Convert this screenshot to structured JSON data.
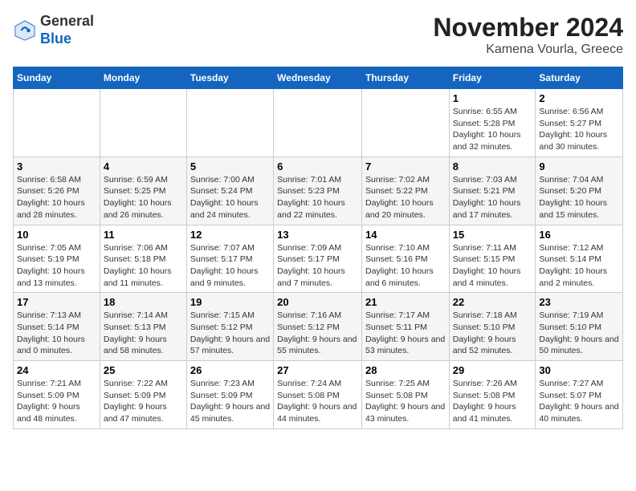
{
  "header": {
    "logo": {
      "line1": "General",
      "line2": "Blue"
    },
    "title": "November 2024",
    "location": "Kamena Vourla, Greece"
  },
  "weekdays": [
    "Sunday",
    "Monday",
    "Tuesday",
    "Wednesday",
    "Thursday",
    "Friday",
    "Saturday"
  ],
  "weeks": [
    [
      {
        "day": "",
        "info": ""
      },
      {
        "day": "",
        "info": ""
      },
      {
        "day": "",
        "info": ""
      },
      {
        "day": "",
        "info": ""
      },
      {
        "day": "",
        "info": ""
      },
      {
        "day": "1",
        "info": "Sunrise: 6:55 AM\nSunset: 5:28 PM\nDaylight: 10 hours and 32 minutes."
      },
      {
        "day": "2",
        "info": "Sunrise: 6:56 AM\nSunset: 5:27 PM\nDaylight: 10 hours and 30 minutes."
      }
    ],
    [
      {
        "day": "3",
        "info": "Sunrise: 6:58 AM\nSunset: 5:26 PM\nDaylight: 10 hours and 28 minutes."
      },
      {
        "day": "4",
        "info": "Sunrise: 6:59 AM\nSunset: 5:25 PM\nDaylight: 10 hours and 26 minutes."
      },
      {
        "day": "5",
        "info": "Sunrise: 7:00 AM\nSunset: 5:24 PM\nDaylight: 10 hours and 24 minutes."
      },
      {
        "day": "6",
        "info": "Sunrise: 7:01 AM\nSunset: 5:23 PM\nDaylight: 10 hours and 22 minutes."
      },
      {
        "day": "7",
        "info": "Sunrise: 7:02 AM\nSunset: 5:22 PM\nDaylight: 10 hours and 20 minutes."
      },
      {
        "day": "8",
        "info": "Sunrise: 7:03 AM\nSunset: 5:21 PM\nDaylight: 10 hours and 17 minutes."
      },
      {
        "day": "9",
        "info": "Sunrise: 7:04 AM\nSunset: 5:20 PM\nDaylight: 10 hours and 15 minutes."
      }
    ],
    [
      {
        "day": "10",
        "info": "Sunrise: 7:05 AM\nSunset: 5:19 PM\nDaylight: 10 hours and 13 minutes."
      },
      {
        "day": "11",
        "info": "Sunrise: 7:06 AM\nSunset: 5:18 PM\nDaylight: 10 hours and 11 minutes."
      },
      {
        "day": "12",
        "info": "Sunrise: 7:07 AM\nSunset: 5:17 PM\nDaylight: 10 hours and 9 minutes."
      },
      {
        "day": "13",
        "info": "Sunrise: 7:09 AM\nSunset: 5:17 PM\nDaylight: 10 hours and 7 minutes."
      },
      {
        "day": "14",
        "info": "Sunrise: 7:10 AM\nSunset: 5:16 PM\nDaylight: 10 hours and 6 minutes."
      },
      {
        "day": "15",
        "info": "Sunrise: 7:11 AM\nSunset: 5:15 PM\nDaylight: 10 hours and 4 minutes."
      },
      {
        "day": "16",
        "info": "Sunrise: 7:12 AM\nSunset: 5:14 PM\nDaylight: 10 hours and 2 minutes."
      }
    ],
    [
      {
        "day": "17",
        "info": "Sunrise: 7:13 AM\nSunset: 5:14 PM\nDaylight: 10 hours and 0 minutes."
      },
      {
        "day": "18",
        "info": "Sunrise: 7:14 AM\nSunset: 5:13 PM\nDaylight: 9 hours and 58 minutes."
      },
      {
        "day": "19",
        "info": "Sunrise: 7:15 AM\nSunset: 5:12 PM\nDaylight: 9 hours and 57 minutes."
      },
      {
        "day": "20",
        "info": "Sunrise: 7:16 AM\nSunset: 5:12 PM\nDaylight: 9 hours and 55 minutes."
      },
      {
        "day": "21",
        "info": "Sunrise: 7:17 AM\nSunset: 5:11 PM\nDaylight: 9 hours and 53 minutes."
      },
      {
        "day": "22",
        "info": "Sunrise: 7:18 AM\nSunset: 5:10 PM\nDaylight: 9 hours and 52 minutes."
      },
      {
        "day": "23",
        "info": "Sunrise: 7:19 AM\nSunset: 5:10 PM\nDaylight: 9 hours and 50 minutes."
      }
    ],
    [
      {
        "day": "24",
        "info": "Sunrise: 7:21 AM\nSunset: 5:09 PM\nDaylight: 9 hours and 48 minutes."
      },
      {
        "day": "25",
        "info": "Sunrise: 7:22 AM\nSunset: 5:09 PM\nDaylight: 9 hours and 47 minutes."
      },
      {
        "day": "26",
        "info": "Sunrise: 7:23 AM\nSunset: 5:09 PM\nDaylight: 9 hours and 45 minutes."
      },
      {
        "day": "27",
        "info": "Sunrise: 7:24 AM\nSunset: 5:08 PM\nDaylight: 9 hours and 44 minutes."
      },
      {
        "day": "28",
        "info": "Sunrise: 7:25 AM\nSunset: 5:08 PM\nDaylight: 9 hours and 43 minutes."
      },
      {
        "day": "29",
        "info": "Sunrise: 7:26 AM\nSunset: 5:08 PM\nDaylight: 9 hours and 41 minutes."
      },
      {
        "day": "30",
        "info": "Sunrise: 7:27 AM\nSunset: 5:07 PM\nDaylight: 9 hours and 40 minutes."
      }
    ]
  ]
}
